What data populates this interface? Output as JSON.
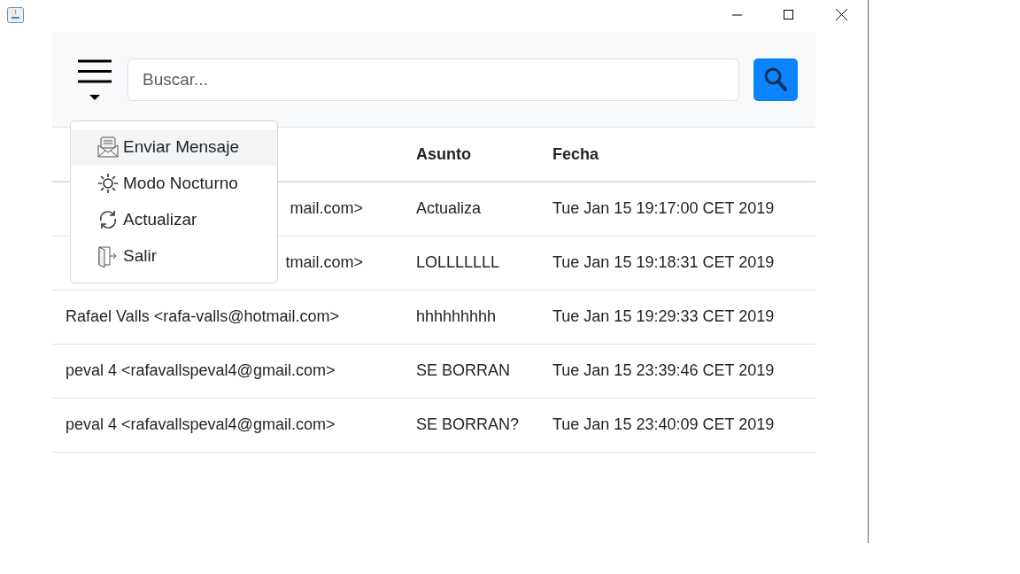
{
  "toolbar": {
    "search": {
      "placeholder": "Buscar..."
    }
  },
  "menu": {
    "expanded": true,
    "items": [
      {
        "label": "Enviar Mensaje",
        "kind": "mail",
        "selected": true
      },
      {
        "label": "Modo Nocturno",
        "kind": "sun",
        "selected": false
      },
      {
        "label": "Actualizar",
        "kind": "refresh",
        "selected": false
      },
      {
        "label": "Salir",
        "kind": "exit",
        "selected": false
      }
    ]
  },
  "table": {
    "columns": [
      {
        "label": "Asunto"
      },
      {
        "label": "Fecha"
      }
    ],
    "rows": [
      {
        "sender": {
          "end": "mail.com>"
        },
        "subject": "Actualiza",
        "date": "Tue Jan 15 19:17:00 CET 2019"
      },
      {
        "sender": {
          "end": "tmail.com>"
        },
        "subject": "LOLLLLLLL",
        "date": "Tue Jan 15 19:18:31 CET 2019"
      },
      {
        "sender": {
          "text": "Rafael Valls <rafa-valls@hotmail.com>"
        },
        "subject": "hhhhhhhhh",
        "date": "Tue Jan 15 19:29:33 CET 2019"
      },
      {
        "sender": {
          "text": "peval 4 <rafavallspeval4@gmail.com>"
        },
        "subject": "SE BORRAN",
        "date": "Tue Jan 15 23:39:46 CET 2019"
      },
      {
        "sender": {
          "text": "peval 4 <rafavallspeval4@gmail.com>"
        },
        "subject": "SE BORRAN?",
        "date": "Tue Jan 15 23:40:09 CET 2019"
      }
    ]
  }
}
